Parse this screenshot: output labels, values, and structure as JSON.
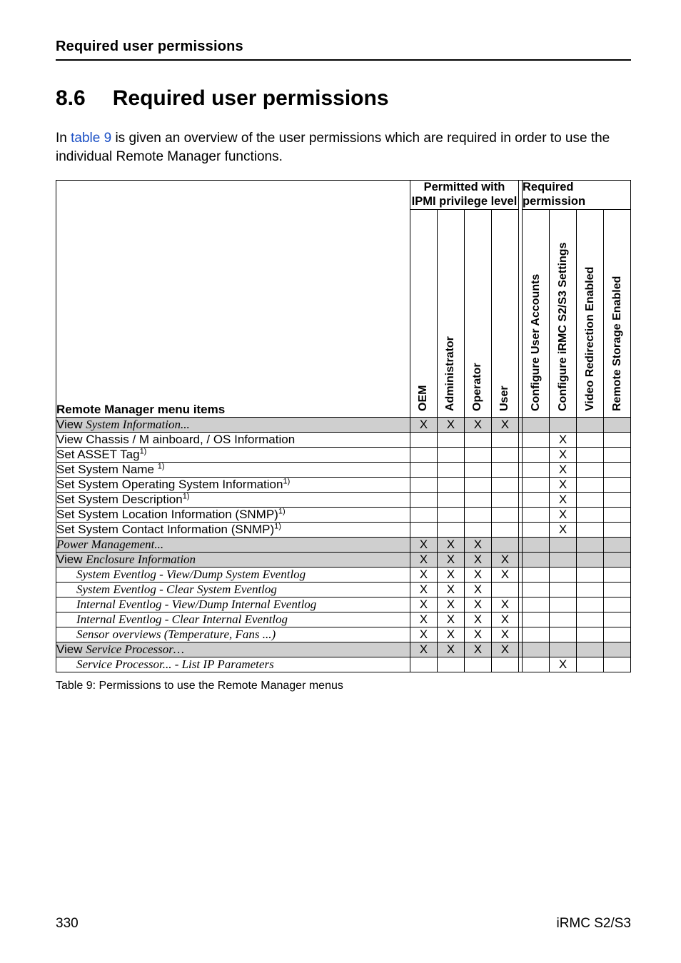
{
  "running_head": "Required user permissions",
  "section": {
    "number": "8.6",
    "title": "Required user permissions"
  },
  "intro": {
    "pre": "In ",
    "link": "table 9",
    "post": " is given an overview of the user permissions which are required in order to use the individual Remote Manager functions."
  },
  "table": {
    "top_left_header": "Remote Manager menu items",
    "group_ipmi": "Permitted with IPMI privilege level",
    "group_req": "Required permission",
    "cols_ipmi": [
      "OEM",
      "Administrator",
      "Operator",
      "User"
    ],
    "cols_req": [
      "Configure User Accounts",
      "Configure iRMC S2/S3 Settings",
      "Video Redirection Enabled",
      "Remote Storage Enabled"
    ],
    "rows": [
      {
        "shaded": true,
        "view_prefix": true,
        "italic_rest": "System Information...",
        "cells": [
          "X",
          "X",
          "X",
          "X",
          "",
          "",
          "",
          ""
        ]
      },
      {
        "shaded": false,
        "label": "View Chassis / M ainboard, / OS Information",
        "cells": [
          "",
          "",
          "",
          "",
          "",
          "X",
          "",
          ""
        ]
      },
      {
        "shaded": false,
        "label_html": "Set ASSET Tag<sup>1)</sup>",
        "cells": [
          "",
          "",
          "",
          "",
          "",
          "X",
          "",
          ""
        ]
      },
      {
        "shaded": false,
        "label_html": "Set System Name <sup>1)</sup>",
        "cells": [
          "",
          "",
          "",
          "",
          "",
          "X",
          "",
          ""
        ]
      },
      {
        "shaded": false,
        "label_html": "Set System Operating System Information<sup>1)</sup>",
        "cells": [
          "",
          "",
          "",
          "",
          "",
          "X",
          "",
          ""
        ]
      },
      {
        "shaded": false,
        "label_html": "Set System Description<sup>1)</sup>",
        "cells": [
          "",
          "",
          "",
          "",
          "",
          "X",
          "",
          ""
        ]
      },
      {
        "shaded": false,
        "label_html": "Set System Location Information (SNMP)<sup>1)</sup>",
        "cells": [
          "",
          "",
          "",
          "",
          "",
          "X",
          "",
          ""
        ]
      },
      {
        "shaded": false,
        "label_html": "Set System Contact Information (SNMP)<sup>1)</sup>",
        "cells": [
          "",
          "",
          "",
          "",
          "",
          "X",
          "",
          ""
        ]
      },
      {
        "shaded": true,
        "italic_label": "Power Management...",
        "cells": [
          "X",
          "X",
          "X",
          "",
          "",
          "",
          "",
          ""
        ]
      },
      {
        "shaded": true,
        "view_prefix": true,
        "italic_rest": "Enclosure Information",
        "cells": [
          "X",
          "X",
          "X",
          "X",
          "",
          "",
          "",
          ""
        ]
      },
      {
        "shaded": false,
        "indent": true,
        "italic_label": "System Eventlog - View/Dump System Eventlog",
        "cells": [
          "X",
          "X",
          "X",
          "X",
          "",
          "",
          "",
          ""
        ]
      },
      {
        "shaded": false,
        "indent": true,
        "italic_label": "System Eventlog - Clear System Eventlog",
        "cells": [
          "X",
          "X",
          "X",
          "",
          "",
          "",
          "",
          ""
        ]
      },
      {
        "shaded": false,
        "indent": true,
        "italic_label": "Internal Eventlog - View/Dump Internal Eventlog",
        "cells": [
          "X",
          "X",
          "X",
          "X",
          "",
          "",
          "",
          ""
        ]
      },
      {
        "shaded": false,
        "indent": true,
        "italic_label": "Internal Eventlog - Clear Internal Eventlog",
        "cells": [
          "X",
          "X",
          "X",
          "X",
          "",
          "",
          "",
          ""
        ]
      },
      {
        "shaded": false,
        "indent": true,
        "italic_label": "Sensor overviews (Temperature, Fans ...)",
        "cells": [
          "X",
          "X",
          "X",
          "X",
          "",
          "",
          "",
          ""
        ]
      },
      {
        "shaded": true,
        "view_prefix": true,
        "italic_rest": "Service Processor…",
        "cells": [
          "X",
          "X",
          "X",
          "X",
          "",
          "",
          "",
          ""
        ]
      },
      {
        "shaded": false,
        "indent": true,
        "italic_label": "Service Processor... - List IP Parameters",
        "cells": [
          "",
          "",
          "",
          "",
          "",
          "X",
          "",
          ""
        ]
      }
    ],
    "caption": "Table 9: Permissions to use the Remote Manager menus"
  },
  "footer": {
    "left": "330",
    "right": "iRMC S2/S3"
  }
}
